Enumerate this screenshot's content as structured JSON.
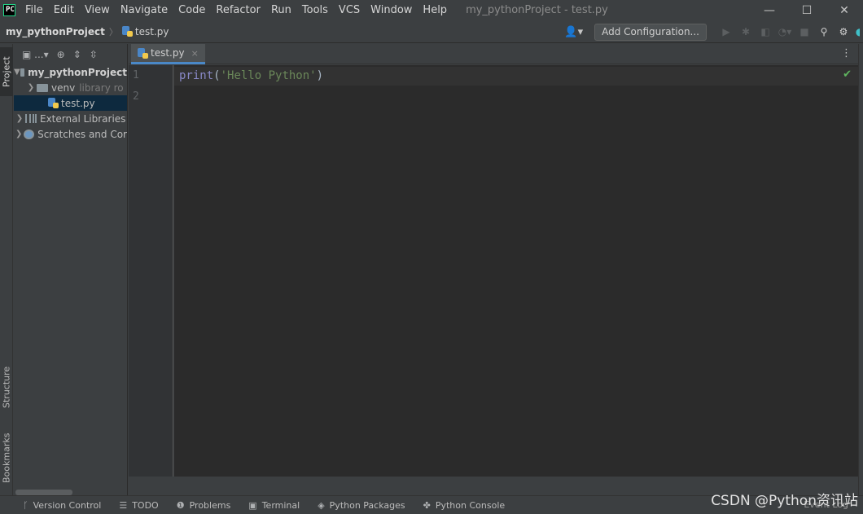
{
  "menu": {
    "items": [
      "File",
      "Edit",
      "View",
      "Navigate",
      "Code",
      "Refactor",
      "Run",
      "Tools",
      "VCS",
      "Window",
      "Help"
    ],
    "window_title": "my_pythonProject - test.py",
    "minimize": "—",
    "maximize": "☐",
    "close": "✕"
  },
  "nav": {
    "project": "my_pythonProject",
    "separator": "〉",
    "file": "test.py",
    "add_configuration": "Add Configuration..."
  },
  "left_stripe": {
    "project": "Project",
    "structure": "Structure",
    "bookmarks": "Bookmarks"
  },
  "project_tree": {
    "toolbar_more": "...",
    "root": "my_pythonProject",
    "venv": "venv",
    "venv_hint": "library ro",
    "file": "test.py",
    "external_libraries": "External Libraries",
    "scratches": "Scratches and Cor"
  },
  "editor": {
    "tab_label": "test.py",
    "tab_close": "×",
    "line_numbers": [
      "1",
      "2"
    ],
    "code": {
      "func": "print",
      "open": "(",
      "string": "'Hello Python'",
      "close": ")"
    }
  },
  "status_bar": {
    "buttons": [
      "Version Control",
      "TODO",
      "Problems",
      "Terminal",
      "Python Packages",
      "Python Console"
    ],
    "event_log": "Event Log"
  },
  "watermark": "CSDN @Python资讯站",
  "colors": {
    "editor_bg": "#2b2b2b",
    "panel_bg": "#3c3f41",
    "selection": "#0d293e",
    "string": "#6a8759",
    "builtin": "#8888c6",
    "tab_underline": "#4a88c7"
  }
}
